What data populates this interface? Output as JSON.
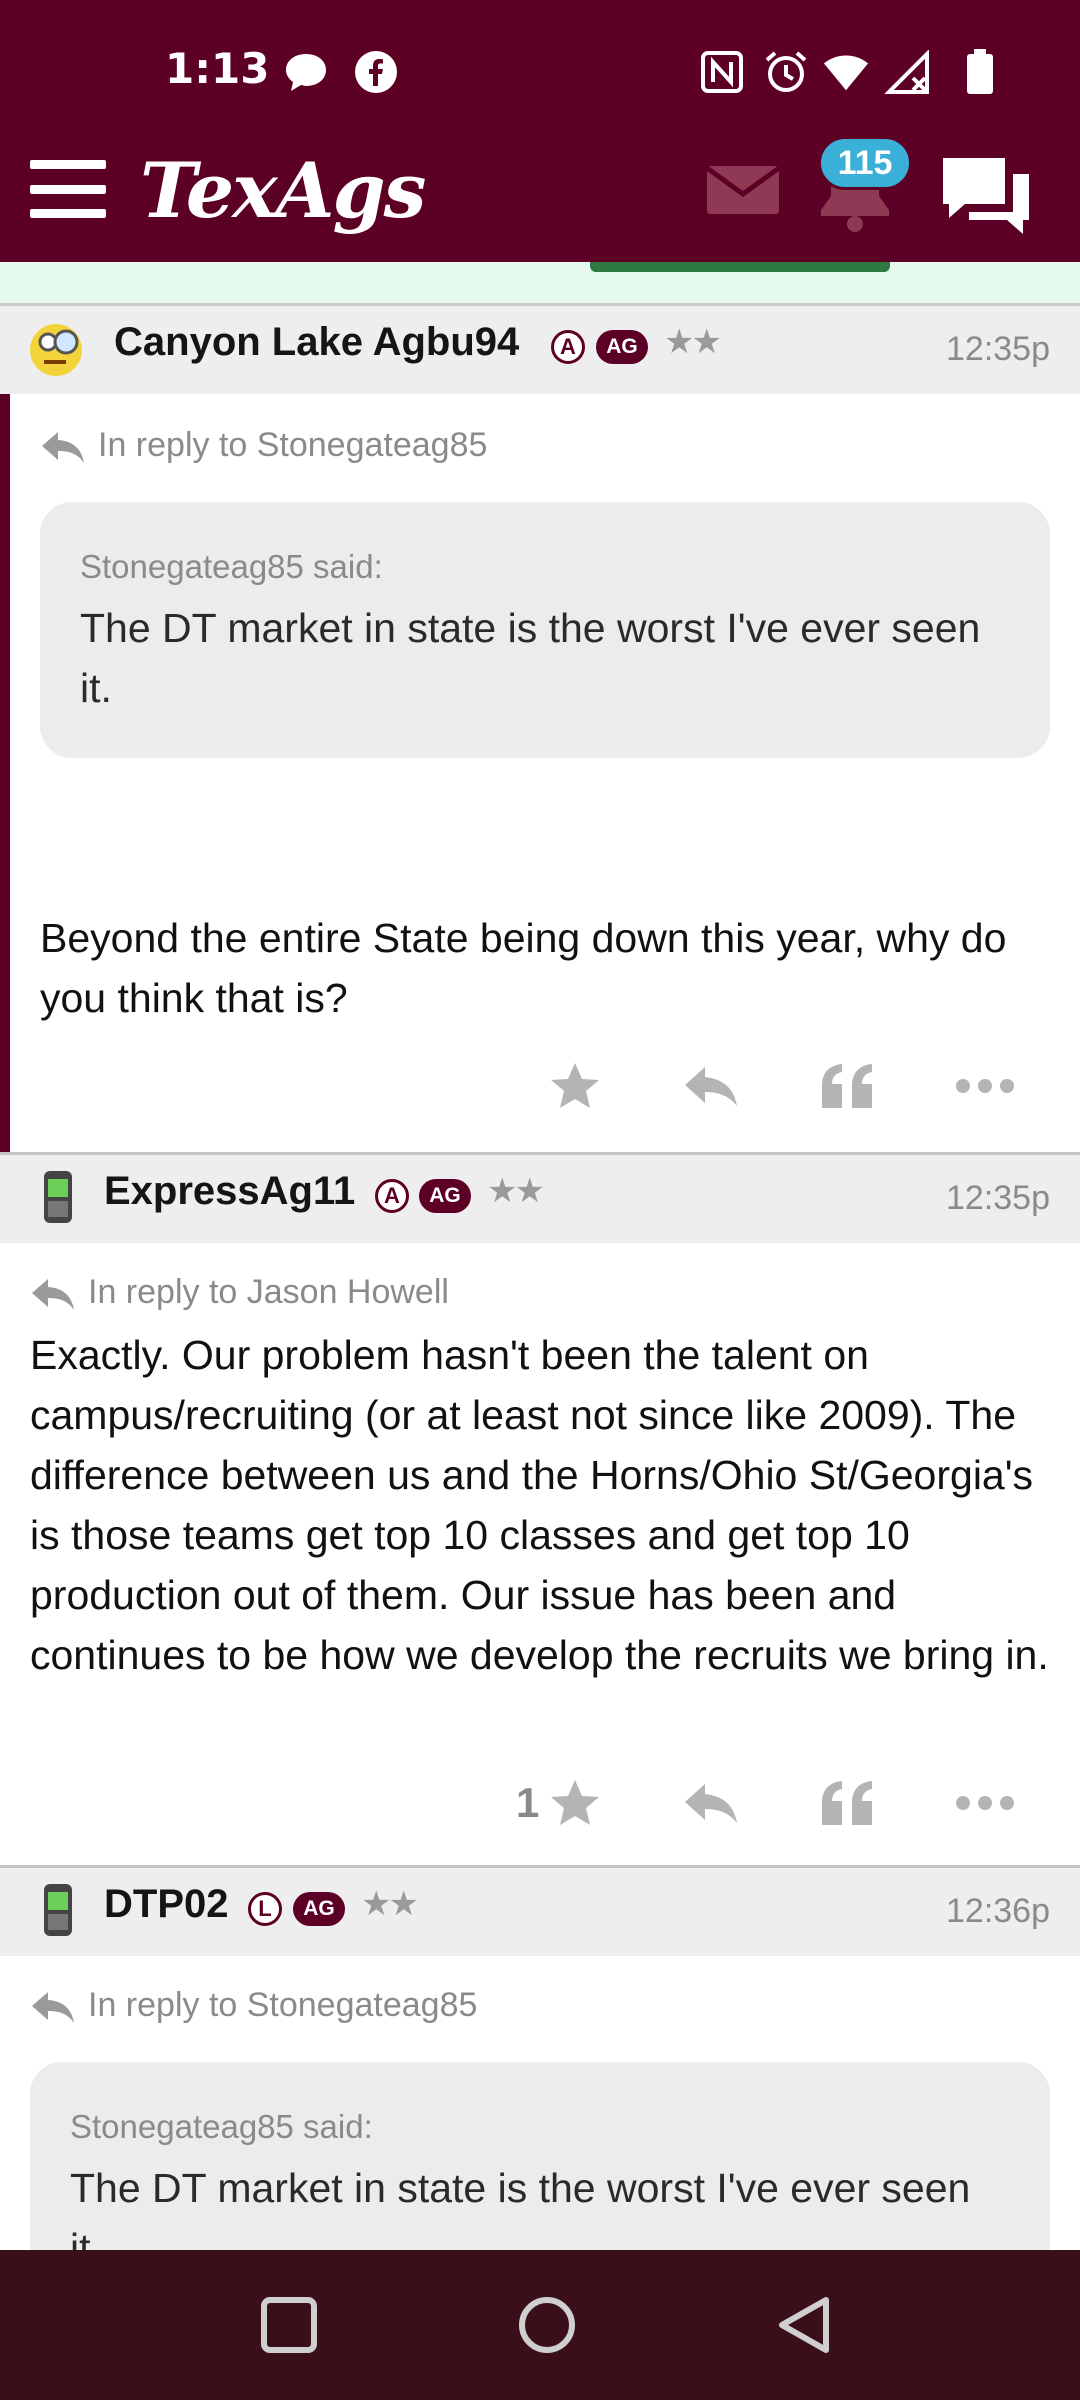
{
  "status_bar": {
    "time": "1:13",
    "icons": [
      "chat-bubble-icon",
      "facebook-icon",
      "nfc-icon",
      "alarm-icon",
      "wifi-icon",
      "signal-icon",
      "battery-icon"
    ]
  },
  "header": {
    "logo": "TexAgs",
    "notification_count": "115",
    "colors": {
      "brand": "#5c0025",
      "badge": "#3ab0d8"
    }
  },
  "posts": [
    {
      "username": "Canyon Lake Agbu94",
      "badge_letter": "A",
      "ag_badge": "AG",
      "stars": "★★",
      "time": "12:35p",
      "reply_to": "In reply to Stonegateag85",
      "quote_author": "Stonegateag85 said:",
      "quote_text": "The DT market in state is the worst I've ever seen it.",
      "body": "Beyond the entire State being down this year, why do you think that is?",
      "like_count": ""
    },
    {
      "username": "ExpressAg11",
      "badge_letter": "A",
      "ag_badge": "AG",
      "stars": "★★",
      "time": "12:35p",
      "reply_to": "In reply to Jason Howell",
      "body": "Exactly. Our problem hasn't been the talent on campus/recruiting (or at least not since like 2009). The difference between us and the Horns/Ohio St/Georgia's is those teams get top 10 classes and get top 10 production out of them. Our issue has been and continues to be how we develop the recruits we bring in.",
      "like_count": "1"
    },
    {
      "username": "DTP02",
      "badge_letter": "L",
      "ag_badge": "AG",
      "stars": "★★",
      "time": "12:36p",
      "reply_to": "In reply to Stonegateag85",
      "quote_author": "Stonegateag85 said:",
      "quote_text": "The DT market in state is the worst I've ever seen it."
    }
  ],
  "system_nav": [
    "recents-button",
    "home-button",
    "back-button"
  ]
}
